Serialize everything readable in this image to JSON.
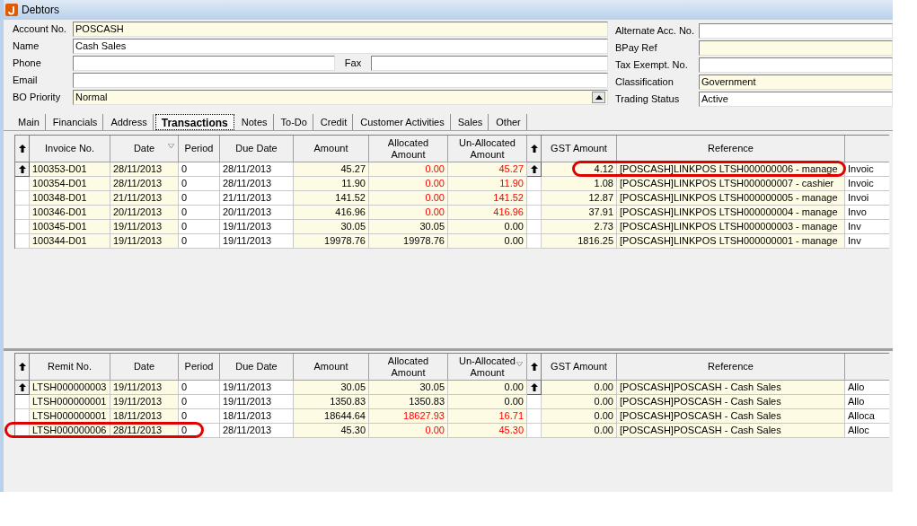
{
  "window": {
    "title": "Debtors"
  },
  "form_left": [
    {
      "label": "Account No.",
      "value": "POSCASH",
      "required": true
    },
    {
      "label": "Name",
      "value": "Cash Sales",
      "required": false
    },
    {
      "label": "Phone",
      "required": false,
      "side_label": "Fax"
    },
    {
      "label": "Email",
      "required": false
    },
    {
      "label": "BO Priority",
      "value": "Normal",
      "required": true,
      "kind": "dropdown"
    }
  ],
  "form_right": [
    {
      "label": "Alternate Acc. No.",
      "required": false
    },
    {
      "label": "BPay Ref",
      "required": true
    },
    {
      "label": "Tax Exempt. No.",
      "required": false
    },
    {
      "label": "Classification",
      "value": "Government",
      "required": true
    },
    {
      "label": "Trading Status",
      "value": "Active",
      "required": false
    }
  ],
  "tabs": [
    {
      "label": "Main",
      "selected": false
    },
    {
      "label": "Financials",
      "selected": false
    },
    {
      "label": "Address",
      "selected": false
    },
    {
      "label": "Transactions",
      "selected": true
    },
    {
      "label": "Notes",
      "selected": false
    },
    {
      "label": "To-Do",
      "selected": false
    },
    {
      "label": "Credit",
      "selected": false
    },
    {
      "label": "Customer Activities",
      "selected": false
    },
    {
      "label": "Sales",
      "selected": false
    },
    {
      "label": "Other",
      "selected": false
    }
  ],
  "invoices": {
    "columns": [
      {
        "label": "Invoice No.",
        "sorted": false
      },
      {
        "label": "Date",
        "sorted": true
      },
      {
        "label": "Period",
        "sorted": false
      },
      {
        "label": "Due Date",
        "sorted": false
      },
      {
        "label": "Amount",
        "sorted": false
      },
      {
        "label": "Allocated Amount",
        "sorted": false
      },
      {
        "label": "Un-Allocated Amount",
        "sorted": false
      },
      {
        "label": "GST Amount",
        "sorted": false
      },
      {
        "label": "Reference",
        "sorted": false
      }
    ],
    "rows": [
      {
        "selected": true,
        "outstanding": true,
        "circled": true,
        "cells": [
          "100353-D01",
          "28/11/2013",
          "0",
          "28/11/2013",
          "45.27",
          "0.00",
          "45.27",
          "4.12",
          "[POSCASH]LINKPOS LTSH000000006 - manage",
          "Invoic"
        ]
      },
      {
        "selected": false,
        "outstanding": true,
        "circled": false,
        "cells": [
          "100354-D01",
          "28/11/2013",
          "0",
          "28/11/2013",
          "11.90",
          "0.00",
          "11.90",
          "1.08",
          "[POSCASH]LINKPOS LTSH000000007 - cashier",
          "Invoic"
        ]
      },
      {
        "selected": false,
        "outstanding": true,
        "circled": false,
        "cells": [
          "100348-D01",
          "21/11/2013",
          "0",
          "21/11/2013",
          "141.52",
          "0.00",
          "141.52",
          "12.87",
          "[POSCASH]LINKPOS LTSH000000005 - manage",
          "Invoi"
        ]
      },
      {
        "selected": false,
        "outstanding": true,
        "circled": false,
        "cells": [
          "100346-D01",
          "20/11/2013",
          "0",
          "20/11/2013",
          "416.96",
          "0.00",
          "416.96",
          "37.91",
          "[POSCASH]LINKPOS LTSH000000004 - manage",
          "Invo"
        ]
      },
      {
        "selected": false,
        "outstanding": false,
        "circled": false,
        "cells": [
          "100345-D01",
          "19/11/2013",
          "0",
          "19/11/2013",
          "30.05",
          "30.05",
          "0.00",
          "2.73",
          "[POSCASH]LINKPOS LTSH000000003 - manage",
          "Inv"
        ]
      },
      {
        "selected": false,
        "outstanding": false,
        "circled": false,
        "cells": [
          "100344-D01",
          "19/11/2013",
          "0",
          "19/11/2013",
          "19978.76",
          "19978.76",
          "0.00",
          "1816.25",
          "[POSCASH]LINKPOS LTSH000000001 - manage",
          "Inv"
        ]
      }
    ]
  },
  "remittances": {
    "columns": [
      {
        "label": "Remit No.",
        "sorted": false
      },
      {
        "label": "Date",
        "sorted": false
      },
      {
        "label": "Period",
        "sorted": false
      },
      {
        "label": "Due Date",
        "sorted": false
      },
      {
        "label": "Amount",
        "sorted": false
      },
      {
        "label": "Allocated Amount",
        "sorted": false
      },
      {
        "label": "Un-Allocated Amount",
        "sorted": true
      },
      {
        "label": "GST Amount",
        "sorted": false
      },
      {
        "label": "Reference",
        "sorted": false
      }
    ],
    "rows": [
      {
        "selected": true,
        "outstanding": false,
        "circled": false,
        "cells": [
          "LTSH000000003",
          "19/11/2013",
          "0",
          "19/11/2013",
          "30.05",
          "30.05",
          "0.00",
          "0.00",
          "[POSCASH]POSCASH - Cash Sales",
          "Allo"
        ]
      },
      {
        "selected": false,
        "outstanding": false,
        "circled": false,
        "cells": [
          "LTSH000000001",
          "19/11/2013",
          "0",
          "19/11/2013",
          "1350.83",
          "1350.83",
          "0.00",
          "0.00",
          "[POSCASH]POSCASH - Cash Sales",
          "Allo"
        ]
      },
      {
        "selected": false,
        "outstanding": true,
        "circled": false,
        "cells": [
          "LTSH000000001",
          "18/11/2013",
          "0",
          "18/11/2013",
          "18644.64",
          "18627.93",
          "16.71",
          "0.00",
          "[POSCASH]POSCASH - Cash Sales",
          "Alloca"
        ]
      },
      {
        "selected": false,
        "outstanding": true,
        "circled": true,
        "cells": [
          "LTSH000000006",
          "28/11/2013",
          "0",
          "28/11/2013",
          "45.30",
          "0.00",
          "45.30",
          "0.00",
          "[POSCASH]POSCASH - Cash Sales",
          "Alloc"
        ]
      }
    ]
  }
}
